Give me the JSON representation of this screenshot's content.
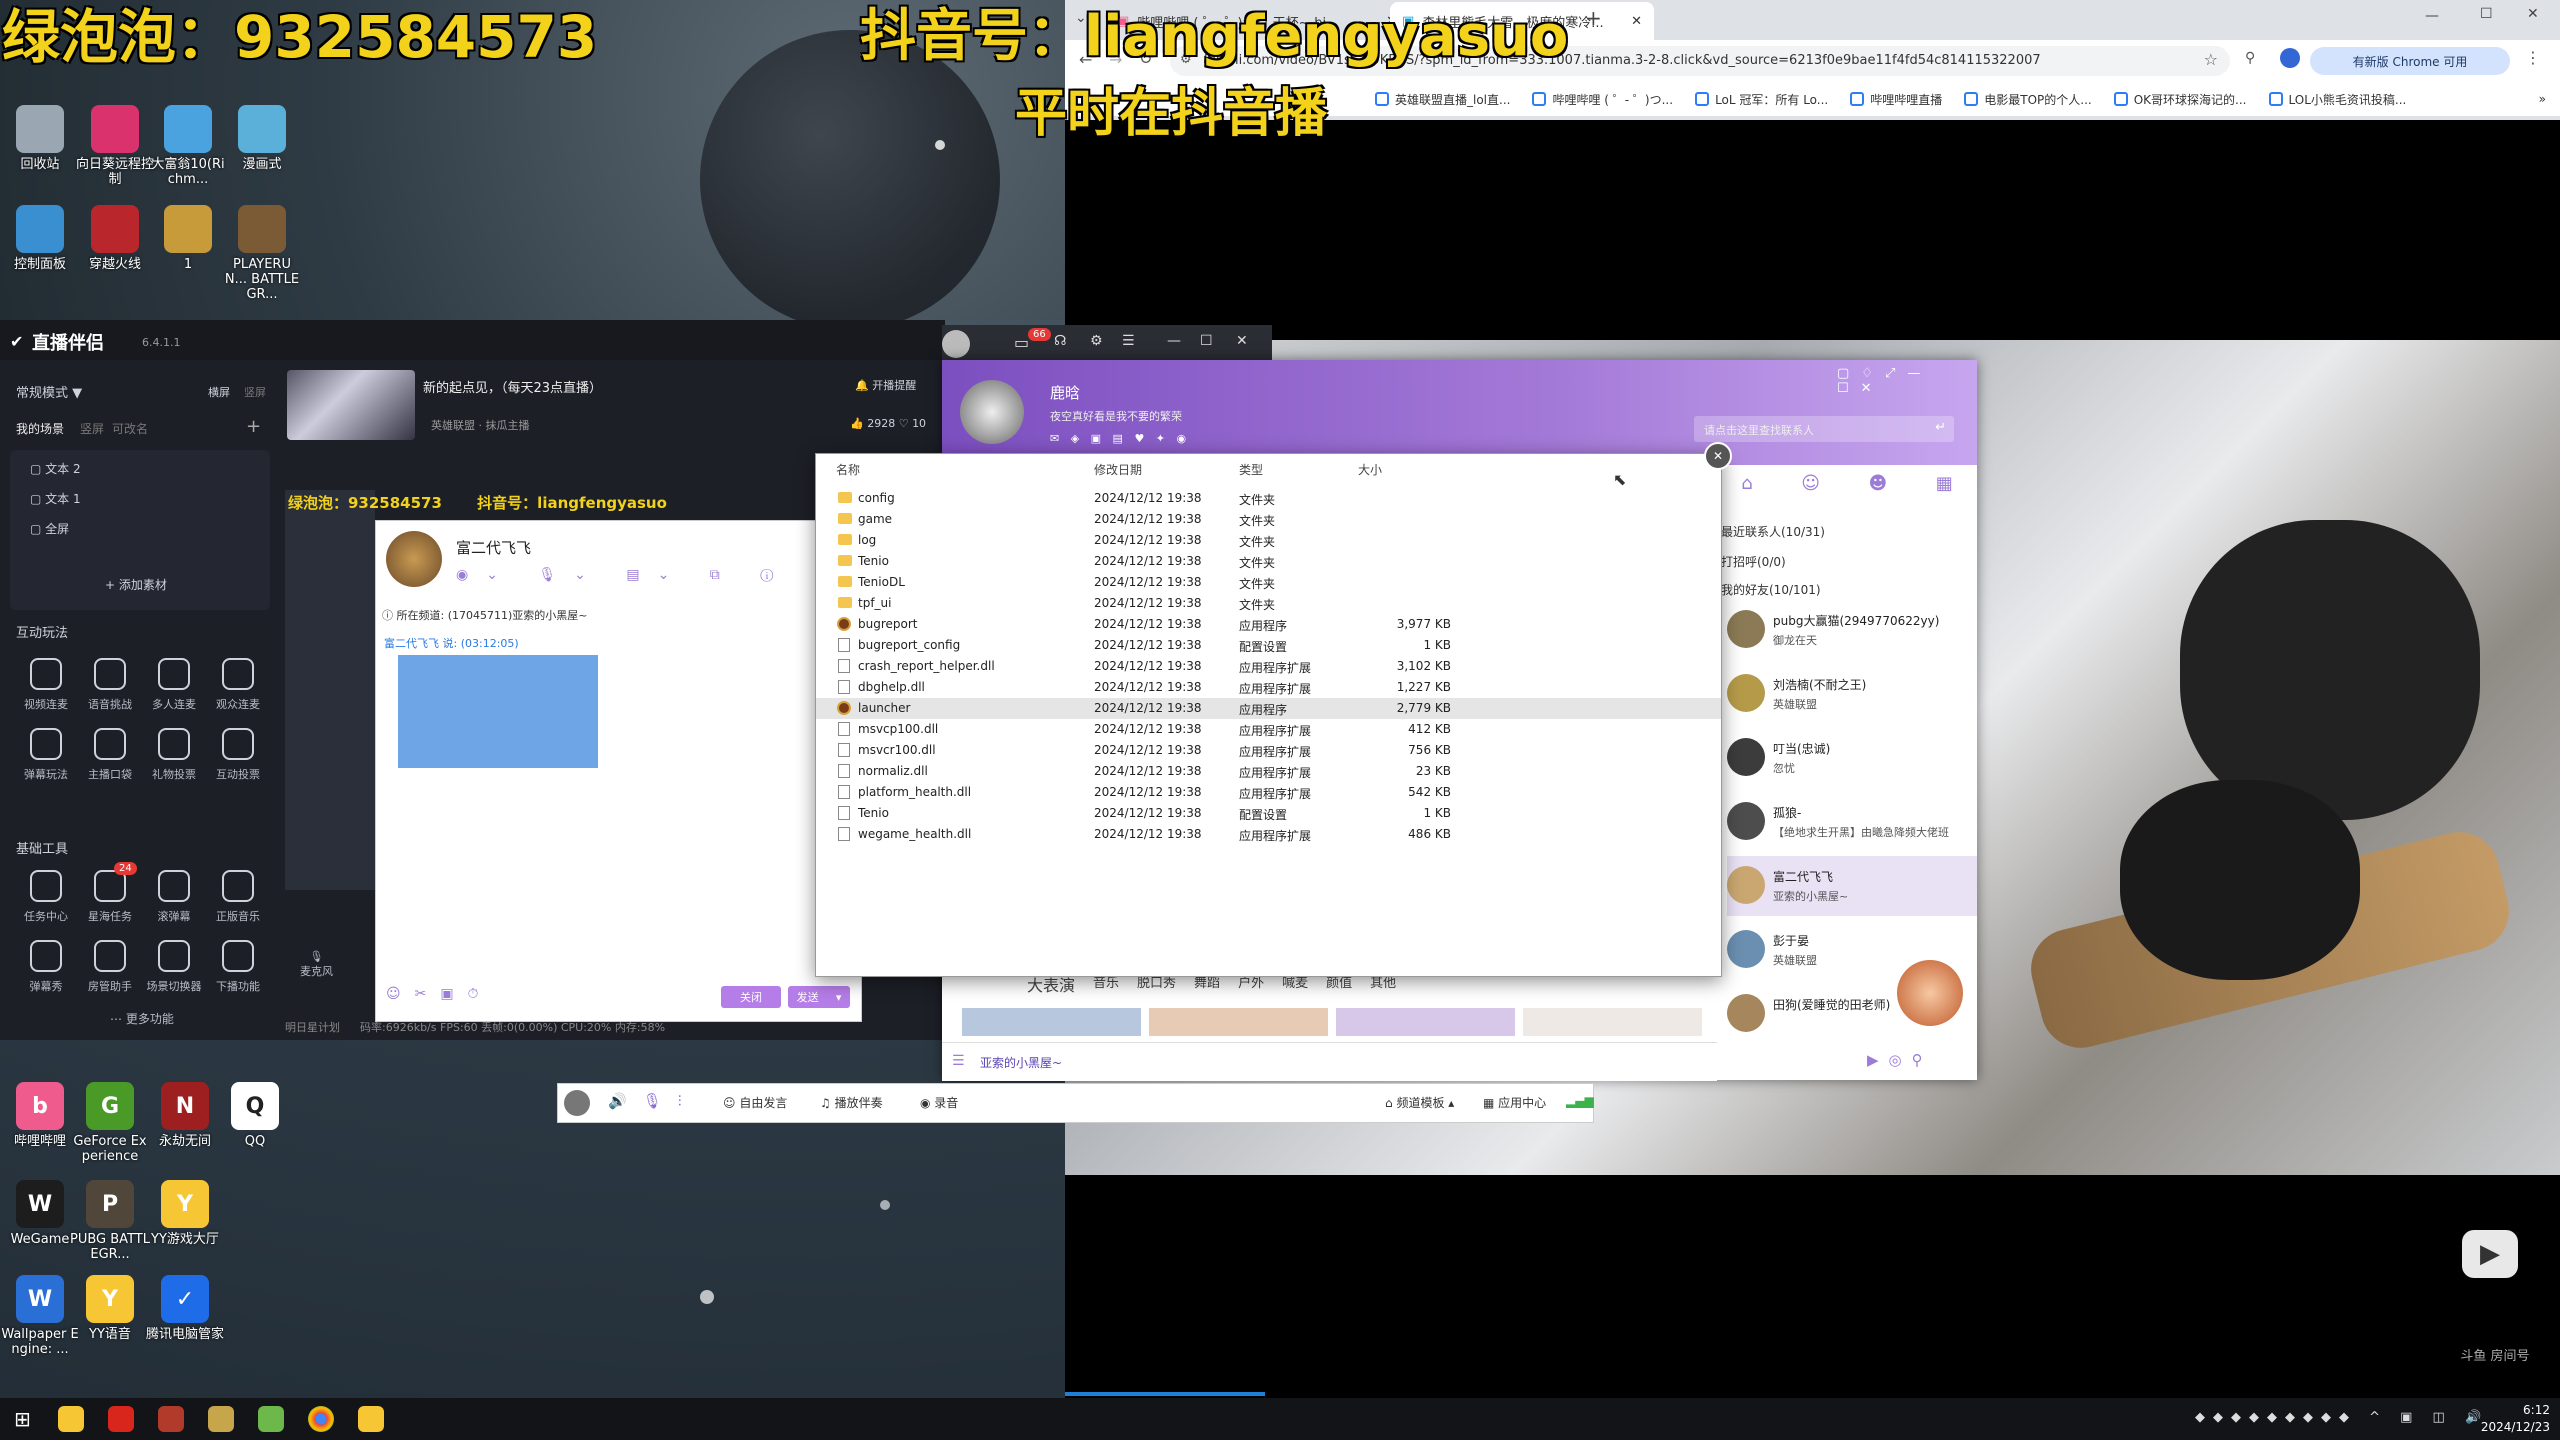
{
  "overlays": {
    "left_prefix": "绿泡泡：",
    "left_number": "932584573",
    "douyin_label": "抖音号：",
    "douyin_id": "liangfengyasuo",
    "douyin_sub": "平时在抖音播",
    "small_left": "绿泡泡：932584573",
    "small_right": "抖音号：liangfengyasuo"
  },
  "desktop_icons_left": [
    {
      "name": "回收站",
      "label": "回收站",
      "color": "#9aa7b3"
    },
    {
      "name": "向日葵远程控制",
      "label": "向日葵远程控制",
      "color": "#d9326d"
    },
    {
      "name": "大富翁10",
      "label": "大富翁10(Richm...",
      "color": "#4aa3df"
    },
    {
      "name": "漫画式",
      "label": "漫画式",
      "color": "#5ab0d8"
    },
    {
      "name": "控制面板",
      "label": "控制面板",
      "color": "#3a8fd1"
    },
    {
      "name": "穿越火线",
      "label": "穿越火线",
      "color": "#b9262c"
    },
    {
      "name": "1",
      "label": "1",
      "color": "#c79a3a"
    },
    {
      "name": "PLAYERUNKNOWN",
      "label": "PLAYERUN... BATTLEGR...",
      "color": "#7a5b36"
    }
  ],
  "desktop_icons_bottom": [
    {
      "label": "哔哩哔哩",
      "color": "#ef5b8c",
      "glyph": "b"
    },
    {
      "label": "GeForce Experience",
      "color": "#4a9a28",
      "glyph": "G"
    },
    {
      "label": "永劫无间",
      "color": "#9d1f1f",
      "glyph": "N"
    },
    {
      "label": "QQ",
      "color": "#ffffff",
      "glyph": "Q"
    },
    {
      "label": "WeGame",
      "color": "#1d1d1d",
      "glyph": "W"
    },
    {
      "label": "PUBG BATTLEGR...",
      "color": "#51463a",
      "glyph": "P"
    },
    {
      "label": "YY游戏大厅",
      "color": "#f7c634",
      "glyph": "Y"
    },
    {
      "label": "Wallpaper Engine: ...",
      "color": "#2a6fd6",
      "glyph": "W"
    },
    {
      "label": "YY语音",
      "color": "#f7c634",
      "glyph": "Y"
    },
    {
      "label": "腾讯电脑管家",
      "color": "#1f6ce8",
      "glyph": "✓"
    }
  ],
  "chrome": {
    "tabs": [
      "哔哩哔哩 ( ゜- ゜)つロ 干杯~-bi...",
      "森林里熊毛大雪，极度的寒冷..."
    ],
    "url": "bilibili.com/video/BV1s...S9KEUS/?spm_id_from=333.1007.tianma.3-2-8.click&vd_source=6213f0e9bae11f4fd54c814115322007",
    "bookmarks": [
      "英雄联盟直播_lol直...",
      "哔哩哔哩 ( ゜- ゜)つ...",
      "LoL 冠军：所有 Lo...",
      "哔哩哔哩直播",
      "电影最TOP的个人...",
      "OK哥环球探海记的...",
      "LOL小熊毛资讯投稿..."
    ],
    "update_btn": "有新版 Chrome 可用"
  },
  "stream_app": {
    "title": "直播伴侣",
    "version": "6.4.1.1",
    "mode": "常规模式",
    "mode_tabs": [
      "横屏",
      "竖屏"
    ],
    "scene_tabs": [
      "我的场景",
      "竖屏",
      "可改名"
    ],
    "scenes": [
      "文本 2",
      "文本 1",
      "全屏"
    ],
    "add_material": "添加素材",
    "room_title": "新的起点见，（每天23点直播）",
    "room_tag": "英雄联盟 · 抹瓜主播",
    "open_remind": "开播提醒",
    "likes": "2928",
    "likes2": "10",
    "section_interact": "互动玩法",
    "interact_tools": [
      "视频连麦",
      "语音挑战",
      "多人连麦",
      "观众连麦",
      "弹幕玩法",
      "主播口袋",
      "礼物投票",
      "互动投票"
    ],
    "section_basic": "基础工具",
    "basic_tools": [
      "任务中心",
      "星海任务",
      "滚弹幕",
      "正版音乐",
      "弹幕秀",
      "房管助手",
      "场景切换器",
      "下播功能"
    ],
    "badge_count": "24",
    "more": "更多功能",
    "mic_label": "麦克风",
    "status_bar": "码率:6926kb/s   FPS:60   丢帧:0(0.00%)   CPU:20%   内存:58%",
    "plan_label": "明日星计划"
  },
  "yy_chat": {
    "name": "富二代飞飞",
    "channel_text": "所在频道: (17045711)亚索的小黑屋~",
    "msg_header": "富二代飞飞 说: (03:12:05)",
    "close_btn": "关闭",
    "send_btn": "发送"
  },
  "messenger": {
    "username": "鹿晗",
    "signature": "夜空真好看是我不要的繁荣",
    "search_placeholder": "请点击这里查找联系人",
    "sections": [
      "最近联系人(10/31)",
      "打招呼(0/0)",
      "我的好友(10/101)"
    ],
    "contacts": [
      {
        "name": "pubg大赢猫(2949770622yy)",
        "status": "御龙在天"
      },
      {
        "name": "刘浩楠(不耐之王)",
        "status": "英雄联盟"
      },
      {
        "name": "叮当(忠诚)",
        "status": "忽忧"
      },
      {
        "name": "孤狼-",
        "status": "【绝地求生开黑】由曦急降频大佬班"
      },
      {
        "name": "富二代飞飞",
        "status": "亚索的小黑屋~"
      },
      {
        "name": "彭于晏",
        "status": "英雄联盟"
      },
      {
        "name": "田狗(爱睡觉的田老师)",
        "status": ""
      }
    ],
    "channel_tabs": [
      "大表演",
      "音乐",
      "脱口秀",
      "舞蹈",
      "户外",
      "喊麦",
      "颜值",
      "其他"
    ],
    "bottom_channel": "亚索的小黑屋~",
    "bottom_bar": [
      "自由发言",
      "播放伴奏",
      "录音"
    ],
    "right_bar": [
      "频道模板",
      "应用中心"
    ],
    "notify_count": "66"
  },
  "file_explorer": {
    "columns": [
      "名称",
      "修改日期",
      "类型",
      "大小"
    ],
    "files": [
      {
        "name": "config",
        "date": "2024/12/12 19:38",
        "type": "文件夹",
        "size": "",
        "kind": "folder"
      },
      {
        "name": "game",
        "date": "2024/12/12 19:38",
        "type": "文件夹",
        "size": "",
        "kind": "folder"
      },
      {
        "name": "log",
        "date": "2024/12/12 19:38",
        "type": "文件夹",
        "size": "",
        "kind": "folder"
      },
      {
        "name": "Tenio",
        "date": "2024/12/12 19:38",
        "type": "文件夹",
        "size": "",
        "kind": "folder"
      },
      {
        "name": "TenioDL",
        "date": "2024/12/12 19:38",
        "type": "文件夹",
        "size": "",
        "kind": "folder"
      },
      {
        "name": "tpf_ui",
        "date": "2024/12/12 19:38",
        "type": "文件夹",
        "size": "",
        "kind": "folder"
      },
      {
        "name": "bugreport",
        "date": "2024/12/12 19:38",
        "type": "应用程序",
        "size": "3,977 KB",
        "kind": "app"
      },
      {
        "name": "bugreport_config",
        "date": "2024/12/12 19:38",
        "type": "配置设置",
        "size": "1 KB",
        "kind": "file"
      },
      {
        "name": "crash_report_helper.dll",
        "date": "2024/12/12 19:38",
        "type": "应用程序扩展",
        "size": "3,102 KB",
        "kind": "file"
      },
      {
        "name": "dbghelp.dll",
        "date": "2024/12/12 19:38",
        "type": "应用程序扩展",
        "size": "1,227 KB",
        "kind": "file"
      },
      {
        "name": "launcher",
        "date": "2024/12/12 19:38",
        "type": "应用程序",
        "size": "2,779 KB",
        "kind": "app",
        "selected": true
      },
      {
        "name": "msvcp100.dll",
        "date": "2024/12/12 19:38",
        "type": "应用程序扩展",
        "size": "412 KB",
        "kind": "file"
      },
      {
        "name": "msvcr100.dll",
        "date": "2024/12/12 19:38",
        "type": "应用程序扩展",
        "size": "756 KB",
        "kind": "file"
      },
      {
        "name": "normaliz.dll",
        "date": "2024/12/12 19:38",
        "type": "应用程序扩展",
        "size": "23 KB",
        "kind": "file"
      },
      {
        "name": "platform_health.dll",
        "date": "2024/12/12 19:38",
        "type": "应用程序扩展",
        "size": "542 KB",
        "kind": "file"
      },
      {
        "name": "Tenio",
        "date": "2024/12/12 19:38",
        "type": "配置设置",
        "size": "1 KB",
        "kind": "file"
      },
      {
        "name": "wegame_health.dll",
        "date": "2024/12/12 19:38",
        "type": "应用程序扩展",
        "size": "486 KB",
        "kind": "file"
      }
    ]
  },
  "taskbar": {
    "date": "2024/12/23",
    "time": "6:12",
    "watermark": "斗鱼 房间号"
  },
  "colors": {
    "overlay_yellow": "#f2d21b",
    "messenger_purple": "#8b5cc6",
    "selected_row": "#e5e5e5",
    "button_purple": "#b57de8"
  }
}
